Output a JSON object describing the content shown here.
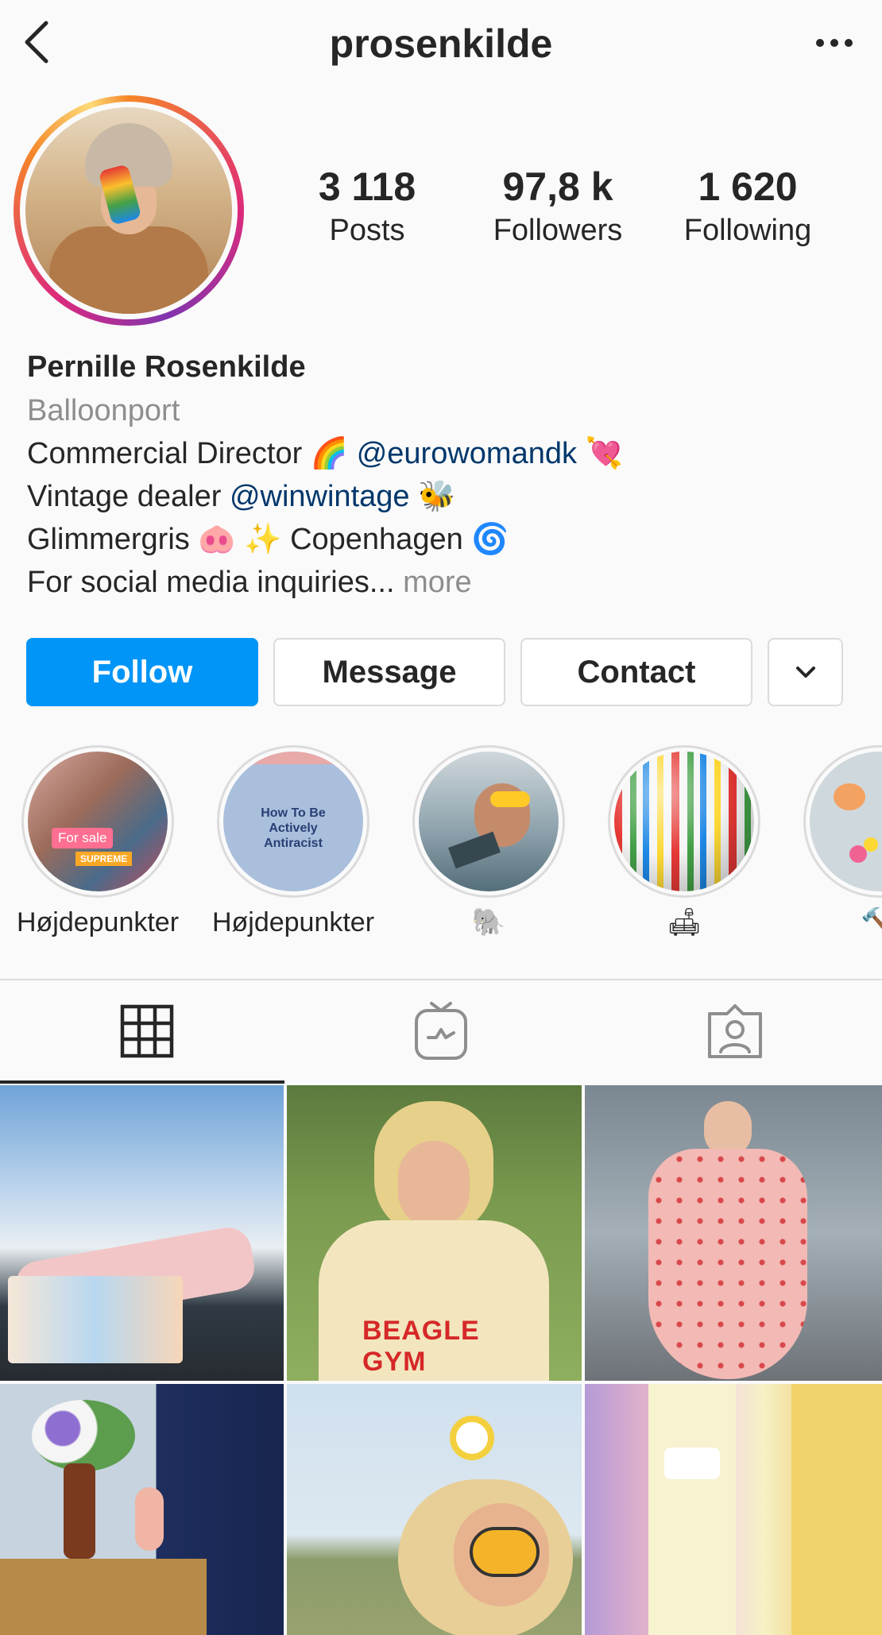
{
  "header": {
    "username": "prosenkilde"
  },
  "stats": {
    "posts": {
      "value": "3 118",
      "label": "Posts"
    },
    "followers": {
      "value": "97,8 k",
      "label": "Followers"
    },
    "following": {
      "value": "1 620",
      "label": "Following"
    }
  },
  "bio": {
    "name": "Pernille Rosenkilde",
    "category": "Balloonport",
    "line1_text": "Commercial Director 🌈 ",
    "line1_mention": "@eurowomandk",
    "line1_emoji": " 💘",
    "line2_text": "Vintage dealer ",
    "line2_mention": "@winwintage",
    "line2_emoji": " 🐝",
    "line3": "Glimmergris 🐽 ✨ Copenhagen 🌀",
    "line4": "For social media inquiries...",
    "more": "more"
  },
  "actions": {
    "follow": "Follow",
    "message": "Message",
    "contact": "Contact"
  },
  "highlights": [
    {
      "label": "Højdepunkter",
      "inner_text": "For sale"
    },
    {
      "label": "Højdepunkter",
      "inner_text": "How To Be Actively Antiracist"
    },
    {
      "label": "🐘"
    },
    {
      "label": "🛋"
    },
    {
      "label": "🔨"
    }
  ],
  "highlight_extra": {
    "supreme": "SUPREME"
  },
  "tabs": [
    {
      "icon": "grid-icon",
      "active": true
    },
    {
      "icon": "igtv-icon",
      "active": false
    },
    {
      "icon": "tagged-icon",
      "active": false
    }
  ],
  "colors": {
    "primary": "#0095f6",
    "text": "#262626",
    "secondary_text": "#8e8e8e",
    "mention": "#00376b",
    "border": "#dbdbdb",
    "background": "#fafafa"
  }
}
